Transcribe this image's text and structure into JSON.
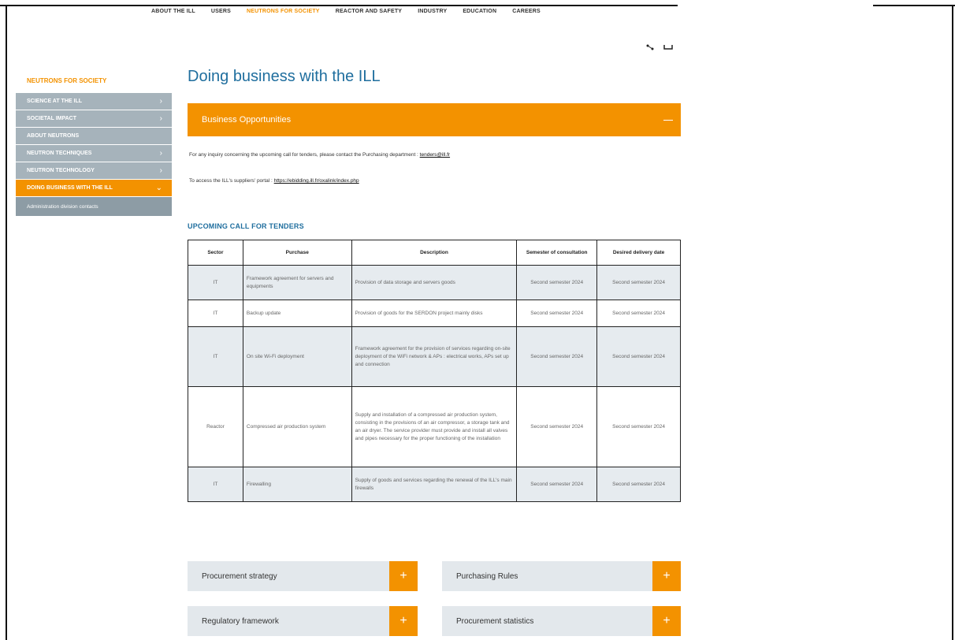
{
  "topnav": {
    "items": [
      "ABOUT THE ILL",
      "USERS",
      "NEUTRONS FOR SOCIETY",
      "REACTOR AND SAFETY",
      "INDUSTRY",
      "EDUCATION",
      "CAREERS"
    ],
    "active_index": 2
  },
  "share": {
    "share_icon": "share-icon",
    "fullscreen_icon": "expand-icon"
  },
  "sidebar": {
    "title": "NEUTRONS FOR SOCIETY",
    "items": [
      {
        "label": "SCIENCE AT THE ILL"
      },
      {
        "label": "SOCIETAL IMPACT"
      },
      {
        "label": "ABOUT NEUTRONS"
      },
      {
        "label": "NEUTRON TECHNIQUES"
      },
      {
        "label": "NEUTRON TECHNOLOGY"
      },
      {
        "label": "DOING BUSINESS WITH THE ILL"
      }
    ],
    "sub_item": "Administration division contacts"
  },
  "main": {
    "title": "Doing business with the ILL",
    "accordion_label": "Business Opportunities",
    "para1_text": "For any inquiry concerning the upcoming call for tenders, please contact the Purchasing department : ",
    "para1_link": "tenders@ill.fr",
    "para2_text": "To access the ILL's suppliers' portal : ",
    "para2_link": "https://ebidding.ill.fr/oxalink/index.php",
    "section_title": "UPCOMING CALL FOR TENDERS"
  },
  "table": {
    "headers": [
      "Sector",
      "Purchase",
      "Description",
      "Semester of consultation",
      "Desired delivery date"
    ],
    "rows": [
      [
        "IT",
        "Framework agreement for servers and equipments",
        "Provision of data storage and servers goods",
        "Second semester 2024",
        "Second semester 2024"
      ],
      [
        "IT",
        "Backup update",
        "Provision of goods for the SERDON project mainly disks",
        "Second semester 2024",
        "Second semester 2024"
      ],
      [
        "IT",
        "On site Wi-Fi deployment",
        "Framework agreement for the provision of services regarding on-site deployment of the WiFi network & APs : electrical works, APs set up and connection",
        "Second semester 2024",
        "Second semester 2024"
      ],
      [
        "Reactor",
        "Compressed air production system",
        "Supply and installation of a compressed air production system, consisting in the provisions of an air compressor, a storage tank and an air dryer. The service provider must provide and install all valves and pipes necessary for the proper functioning of the installation",
        "Second semester 2024",
        "Second semester 2024"
      ],
      [
        "IT",
        "Firewalling",
        "Supply of goods and services regarding the renewal of the ILL's main firewalls",
        "Second semester 2024",
        "Second semester 2024"
      ]
    ]
  },
  "tiles": [
    {
      "label": "Procurement strategy"
    },
    {
      "label": "Purchasing Rules"
    },
    {
      "label": "Regulatory framework"
    },
    {
      "label": "Procurement statistics"
    }
  ],
  "colors": {
    "accent": "#f39200",
    "title_blue": "#1f6e9e",
    "sidebar_grey": "#a6b3bb"
  }
}
